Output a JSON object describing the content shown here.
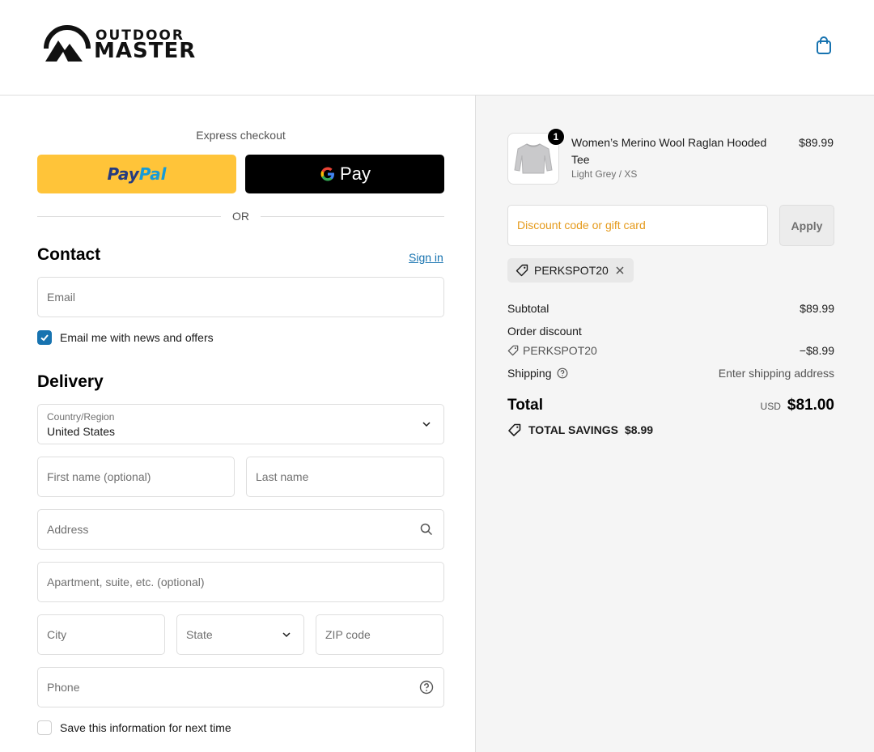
{
  "header": {
    "brand_line1": "OUTDOOR",
    "brand_line2": "MASTER",
    "cart_icon": "shopping-bag-icon"
  },
  "express": {
    "title": "Express checkout",
    "paypal_part1": "Pay",
    "paypal_part2": "Pal",
    "gpay_label": "Pay",
    "or_label": "OR"
  },
  "contact": {
    "title": "Contact",
    "signin_label": "Sign in",
    "email_placeholder": "Email",
    "newsletter_label": "Email me with news and offers",
    "newsletter_checked": true
  },
  "delivery": {
    "title": "Delivery",
    "country_label": "Country/Region",
    "country_value": "United States",
    "first_name_placeholder": "First name (optional)",
    "last_name_placeholder": "Last name",
    "address_placeholder": "Address",
    "apartment_placeholder": "Apartment, suite, etc. (optional)",
    "city_placeholder": "City",
    "state_placeholder": "State",
    "zip_placeholder": "ZIP code",
    "phone_placeholder": "Phone",
    "save_info_label": "Save this information for next time",
    "save_info_checked": false
  },
  "summary": {
    "product": {
      "quantity": "1",
      "name": "Women’s Merino Wool Raglan Hooded Tee",
      "variant": "Light Grey / XS",
      "price": "$89.99"
    },
    "discount_placeholder": "Discount code or gift card",
    "apply_label": "Apply",
    "applied_code": "PERKSPOT20",
    "subtotal_label": "Subtotal",
    "subtotal_value": "$89.99",
    "order_discount_label": "Order discount",
    "discount_code": "PERKSPOT20",
    "discount_value": "−$8.99",
    "shipping_label": "Shipping",
    "shipping_value": "Enter shipping address",
    "total_label": "Total",
    "total_currency": "USD",
    "total_value": "$81.00",
    "savings_label": "TOTAL SAVINGS",
    "savings_value": "$8.99"
  },
  "colors": {
    "paypal_yellow": "#ffc439",
    "link_blue": "#1773b0",
    "discount_placeholder": "#e59a1b",
    "summary_bg": "#f5f5f5"
  }
}
